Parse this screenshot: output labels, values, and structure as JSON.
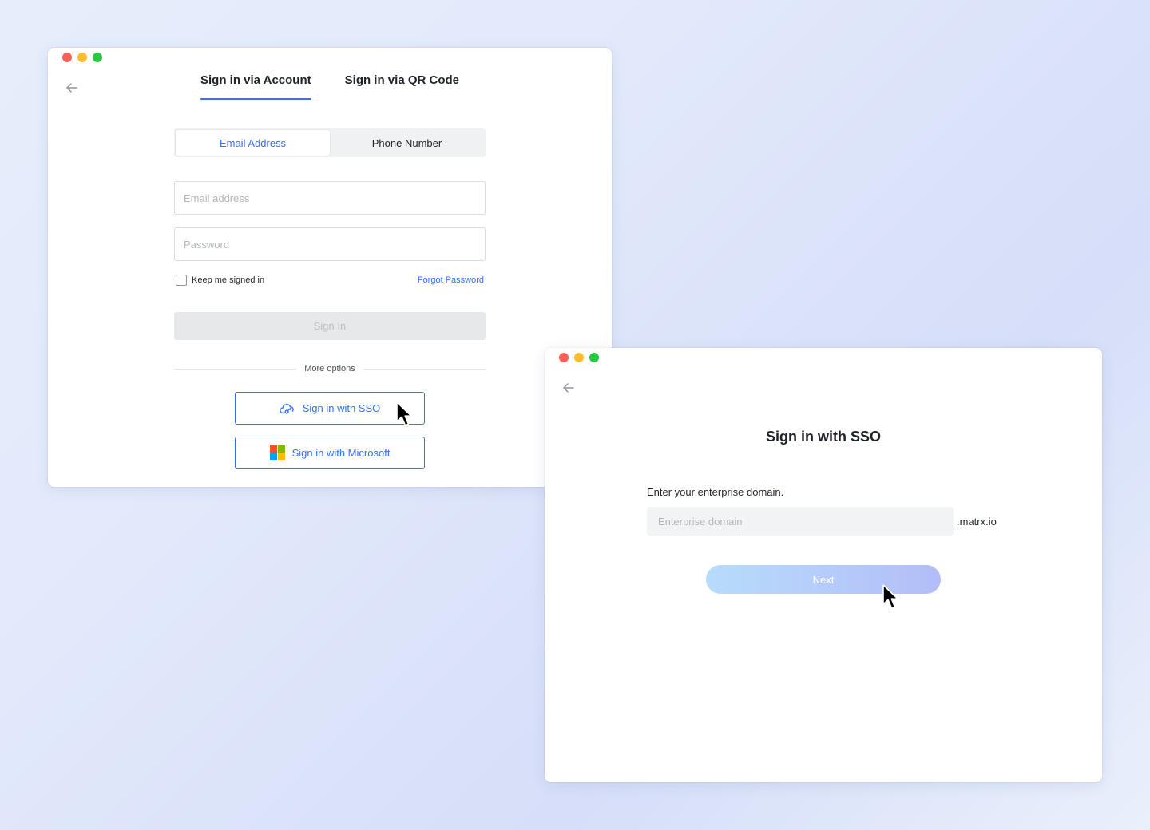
{
  "window_controls": {
    "close_color": "#ff5f57",
    "minimize_color": "#febc2e",
    "maximize_color": "#28c840"
  },
  "signin_window": {
    "back_icon": "arrow-left-icon",
    "tabs": [
      {
        "label": "Sign in via Account",
        "active": true
      },
      {
        "label": "Sign in via QR Code",
        "active": false
      }
    ],
    "segments": [
      {
        "label": "Email Address",
        "active": true
      },
      {
        "label": "Phone Number",
        "active": false
      }
    ],
    "email": {
      "placeholder": "Email address",
      "value": ""
    },
    "password": {
      "placeholder": "Password",
      "value": ""
    },
    "keep_signed_in": {
      "label": "Keep me signed in",
      "checked": false
    },
    "forgot_password": "Forgot Password",
    "signin_button": "Sign In",
    "more_options": "More options",
    "sso_button": {
      "label": "Sign in with SSO",
      "icon": "cloud-key-icon"
    },
    "microsoft_button": {
      "label": "Sign in with Microsoft",
      "icon": "microsoft-logo-icon"
    }
  },
  "sso_window": {
    "back_icon": "arrow-left-icon",
    "title": "Sign in with SSO",
    "instruction": "Enter your enterprise domain.",
    "domain_input": {
      "placeholder": "Enterprise domain",
      "value": ""
    },
    "domain_suffix": ".matrx.io",
    "next_button": "Next"
  },
  "colors": {
    "accent": "#3370ff",
    "microsoft": [
      "#f25022",
      "#7fba00",
      "#00a4ef",
      "#ffb900"
    ]
  }
}
